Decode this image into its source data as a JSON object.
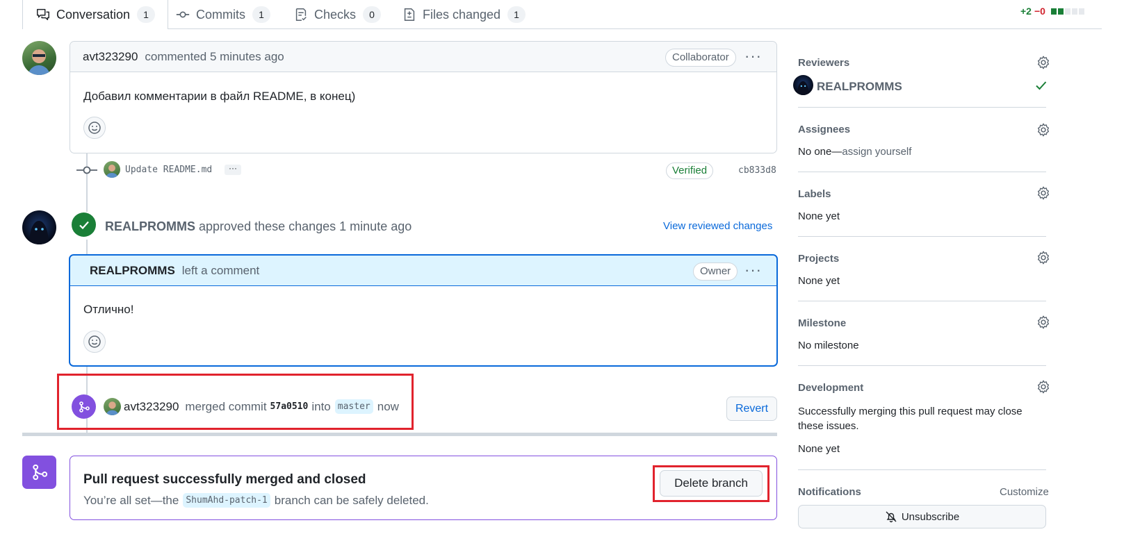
{
  "tabs": [
    {
      "label": "Conversation",
      "count": "1",
      "icon": "comment-discussion-icon"
    },
    {
      "label": "Commits",
      "count": "1",
      "icon": "git-commit-icon"
    },
    {
      "label": "Checks",
      "count": "0",
      "icon": "checklist-icon"
    },
    {
      "label": "Files changed",
      "count": "1",
      "icon": "file-diff-icon"
    }
  ],
  "diffstat": {
    "additions": "+2",
    "deletions": "−0"
  },
  "comment1": {
    "author": "avt323290",
    "action": "commented 5 minutes ago",
    "badge": "Collaborator",
    "body": "Добавил комментарии в файл README, в конец)"
  },
  "commit": {
    "message": "Update README.md",
    "more": "···",
    "verified": "Verified",
    "sha": "cb833d8"
  },
  "review": {
    "author": "REALPROMMS",
    "action": "approved these changes 1 minute ago",
    "link": "View reviewed changes"
  },
  "comment2": {
    "author": "REALPROMMS",
    "action": "left a comment",
    "badge": "Owner",
    "body": "Отлично!"
  },
  "merge_event": {
    "author": "avt323290",
    "text1": "merged commit",
    "sha": "57a0510",
    "text2": "into",
    "branch": "master",
    "when": "now",
    "revert": "Revert"
  },
  "merged_box": {
    "title": "Pull request successfully merged and closed",
    "text1": "You’re all set—the",
    "branch": "ShumAhd-patch-1",
    "text2": "branch can be safely deleted.",
    "button": "Delete branch"
  },
  "sidebar": {
    "reviewers": {
      "title": "Reviewers",
      "name": "REALPROMMS"
    },
    "assignees": {
      "title": "Assignees",
      "none": "No one—",
      "assign": "assign yourself"
    },
    "labels": {
      "title": "Labels",
      "value": "None yet"
    },
    "projects": {
      "title": "Projects",
      "value": "None yet"
    },
    "milestone": {
      "title": "Milestone",
      "value": "No milestone"
    },
    "development": {
      "title": "Development",
      "desc": "Successfully merging this pull request may close these issues.",
      "value": "None yet"
    },
    "notifications": {
      "title": "Notifications",
      "customize": "Customize",
      "button": "Unsubscribe"
    }
  },
  "colors": {
    "merged": "#8250df",
    "approved": "#1a7f37",
    "link": "#0969da",
    "highlight": "#e1232d"
  }
}
